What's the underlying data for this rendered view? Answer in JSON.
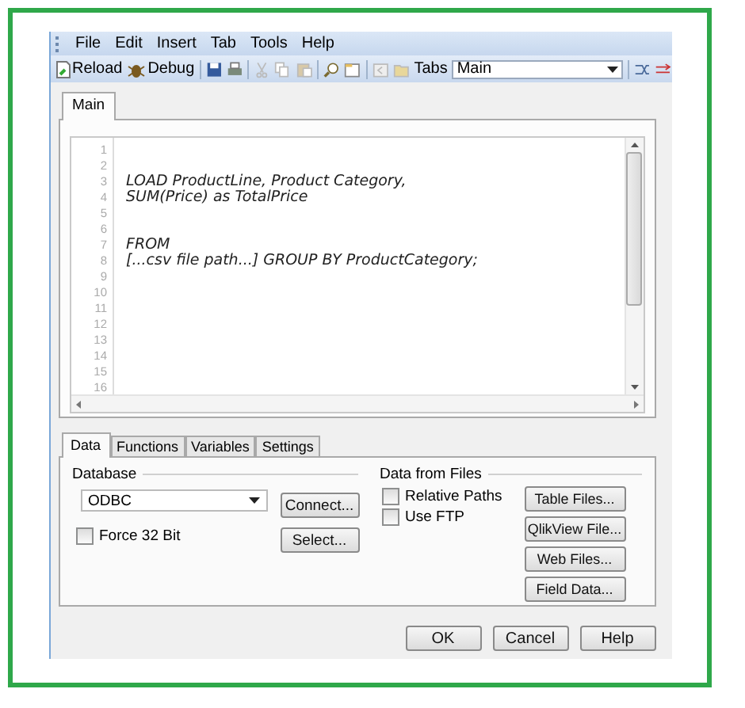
{
  "menu": [
    "File",
    "Edit",
    "Insert",
    "Tab",
    "Tools",
    "Help"
  ],
  "toolbar": {
    "buttons": [
      {
        "label": "Reload",
        "kind": "reload"
      },
      {
        "label": "Debug",
        "kind": "debug"
      }
    ],
    "tabs_label": "Tabs",
    "tab_select": "Main"
  },
  "editor_tabs": [
    {
      "label": "Main",
      "selected": true
    }
  ],
  "script": {
    "lines": [
      {
        "number": "1"
      },
      {
        "number": "2"
      },
      {
        "number": "3",
        "code": "LOAD ProductLine, Product Category,"
      },
      {
        "number": "4",
        "code": "SUM(Price) as TotalPrice"
      },
      {
        "number": "5"
      },
      {
        "number": "6"
      },
      {
        "number": "7",
        "code": "FROM"
      },
      {
        "number": "8",
        "code": "[...csv file path...] GROUP BY ProductCategory;"
      },
      {
        "number": "9"
      },
      {
        "number": "10"
      },
      {
        "number": "11"
      },
      {
        "number": "12"
      },
      {
        "number": "13"
      },
      {
        "number": "14"
      },
      {
        "number": "15"
      },
      {
        "number": "16"
      }
    ]
  },
  "panel_tabs": [
    {
      "label": "Data",
      "selected": true
    },
    {
      "label": "Functions",
      "selected": false
    },
    {
      "label": "Variables",
      "selected": false
    },
    {
      "label": "Settings",
      "selected": false
    }
  ],
  "database": {
    "title": "Database",
    "driver": "ODBC",
    "force_32bit": {
      "label": "Force 32 Bit",
      "checked": false
    },
    "buttons": [
      "Connect...",
      "Select..."
    ]
  },
  "files": {
    "title": "Data from Files",
    "options": [
      {
        "label": "Relative Paths",
        "checked": false
      },
      {
        "label": "Use FTP",
        "checked": false
      }
    ],
    "buttons": [
      "Table Files...",
      "QlikView File...",
      "Web Files...",
      "Field Data..."
    ]
  },
  "dialog_buttons": [
    "OK",
    "Cancel",
    "Help"
  ]
}
